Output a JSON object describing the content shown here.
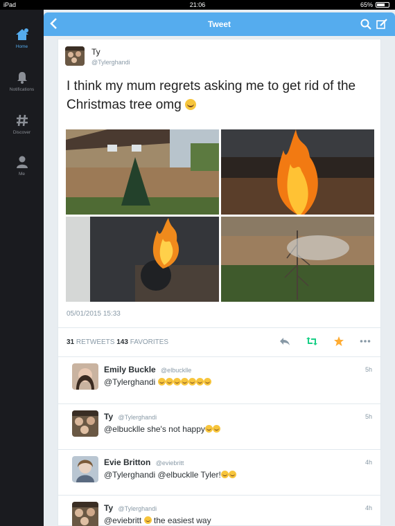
{
  "status_bar": {
    "device": "iPad",
    "time": "21:06",
    "battery": "65%"
  },
  "sidebar": {
    "items": [
      {
        "label": "Home",
        "icon": "home-icon",
        "active": true
      },
      {
        "label": "Notifications",
        "icon": "bell-icon",
        "active": false
      },
      {
        "label": "Discover",
        "icon": "hashtag-icon",
        "active": false
      },
      {
        "label": "Me",
        "icon": "person-icon",
        "active": false
      }
    ]
  },
  "header": {
    "title": "Tweet"
  },
  "tweet": {
    "name": "Ty",
    "handle": "@Tylerghandi",
    "text": "I think my mum regrets asking me to get rid of the Christmas tree omg",
    "timestamp": "05/01/2015 15:33",
    "retweets": "31",
    "retweets_label": "RETWEETS",
    "favorites": "143",
    "favorites_label": "FAVORITES"
  },
  "replies": [
    {
      "name": "Emily Buckle",
      "handle": "@elbucklle",
      "text": "@Tylerghandi",
      "emoji_count": 7,
      "time": "5h"
    },
    {
      "name": "Ty",
      "handle": "@Tylerghandi",
      "text": "@elbucklle she's not happy",
      "emoji_count": 2,
      "time": "5h"
    },
    {
      "name": "Evie Britton",
      "handle": "@eviebritt",
      "text": "@Tylerghandi @elbucklle Tyler!",
      "emoji_count": 2,
      "time": "4h"
    },
    {
      "name": "Ty",
      "handle": "@Tylerghandi",
      "text": "@eviebritt",
      "text_after": "the easiest way",
      "emoji_count": 1,
      "time": "4h"
    }
  ],
  "colors": {
    "accent": "#55acee",
    "favorite": "#ffac33",
    "retweet": "#19cf86",
    "sidebar": "#1a1b1f"
  }
}
